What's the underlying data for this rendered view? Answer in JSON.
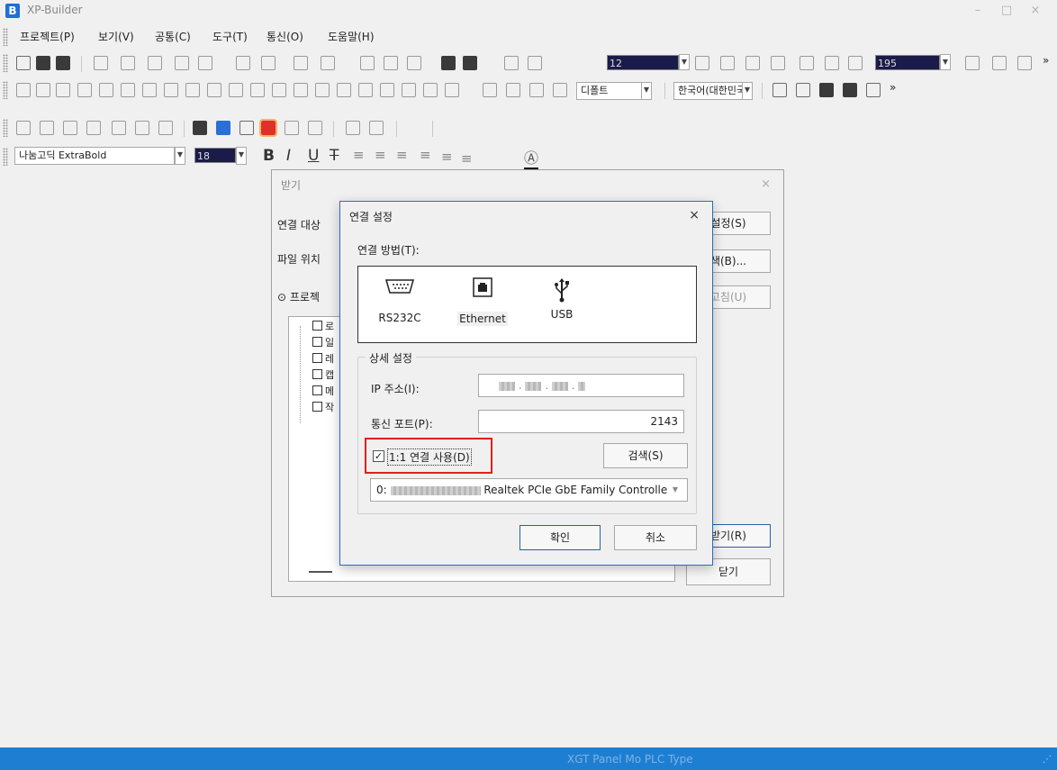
{
  "app": {
    "icon_letter": "B",
    "title": "XP-Builder",
    "minimize": "–",
    "maximize": "□",
    "close": "×"
  },
  "menu": {
    "items": [
      "프로젝트(P)",
      "보기(V)",
      "공통(C)",
      "도구(T)",
      "통신(O)",
      "도움말(H)"
    ]
  },
  "toolbar": {
    "font_size_value": "12",
    "zoom_value": "195",
    "language_combo": "디폴트",
    "locale_combo": "한국어(대한민국",
    "font_combo": "나눔고딕 ExtraBold",
    "text_size_value": "18",
    "more": "»"
  },
  "receive_dialog": {
    "title": "받기",
    "close": "×",
    "connect_target_label": "연결 대상",
    "file_location_label": "파일 위치",
    "radio_label": "프로젝",
    "settings_button": "설정(S)",
    "browse_button": "색(B)...",
    "fix_button": "고침(U)",
    "receive_button": "받기(R)",
    "close_button": "닫기",
    "tree_items": [
      "로",
      "일",
      "레",
      "캡",
      "메",
      "작"
    ]
  },
  "connection_dialog": {
    "title": "연결 설정",
    "close": "×",
    "method_label": "연결 방법(T):",
    "methods": [
      {
        "label": "RS232C",
        "icon": "serial-port-icon"
      },
      {
        "label": "Ethernet",
        "icon": "ethernet-port-icon"
      },
      {
        "label": "USB",
        "icon": "usb-icon"
      }
    ],
    "selected_method": "Ethernet",
    "detail_label": "상세 설정",
    "ip_label": "IP 주소(I):",
    "port_label": "통신 포트(P):",
    "port_value": "2143",
    "one_to_one_label": "1:1 연결 사용(D)",
    "one_to_one_checked": true,
    "search_button": "검색(S)",
    "adapter_prefix": "0:",
    "adapter_name": "Realtek PCIe GbE Family Controlle",
    "ok_button": "확인",
    "cancel_button": "취소"
  },
  "status": {
    "text": "XGT Panel Mo  PLC Type"
  },
  "colors": {
    "accent": "#1e7fd2",
    "highlight": "#e0201a",
    "dialog_border": "#2e6ac0"
  }
}
